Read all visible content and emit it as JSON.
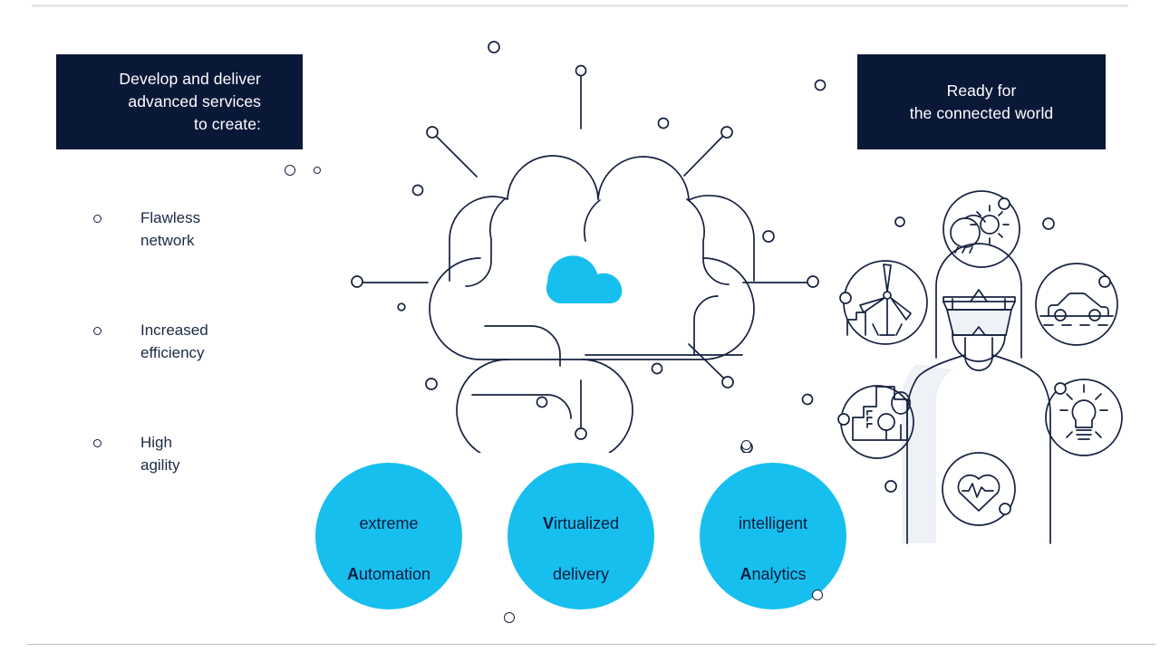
{
  "slide": {
    "background_color": "#ffffff",
    "accent_color": "#17bfef",
    "dark_color": "#0a1838",
    "line_color": "#16223f"
  },
  "callout_left": {
    "lines": [
      "Develop and deliver",
      "advanced services",
      "to create:"
    ]
  },
  "callout_right": {
    "lines": [
      "Ready for",
      "the connected world"
    ]
  },
  "bullets": [
    {
      "text": "Flawless\nnetwork"
    },
    {
      "text": "Increased\nefficiency"
    },
    {
      "text": "High\nagility"
    }
  ],
  "ava_circles": [
    {
      "line1_plain": "extreme",
      "line2_bold": "A",
      "line2_plain": "utomation"
    },
    {
      "line1_bold": "V",
      "line1_plain": "irtualized",
      "line2_plain": "delivery"
    },
    {
      "line1_plain": "intelligent",
      "line2_bold": "A",
      "line2_plain": "nalytics"
    }
  ],
  "center_illustration": {
    "name": "brain-cloud-network",
    "cloud_color": "#17bfef"
  },
  "right_illustration": {
    "name": "person-with-vr-headset",
    "icons": [
      {
        "name": "weather-cloud-sun-icon",
        "label": "weather"
      },
      {
        "name": "wind-turbine-icon",
        "label": "wind turbine"
      },
      {
        "name": "car-on-road-icon",
        "label": "connected car"
      },
      {
        "name": "city-buildings-icon",
        "label": "smart city"
      },
      {
        "name": "lightbulb-icon",
        "label": "lightbulb"
      },
      {
        "name": "heart-pulse-icon",
        "label": "health"
      }
    ]
  }
}
